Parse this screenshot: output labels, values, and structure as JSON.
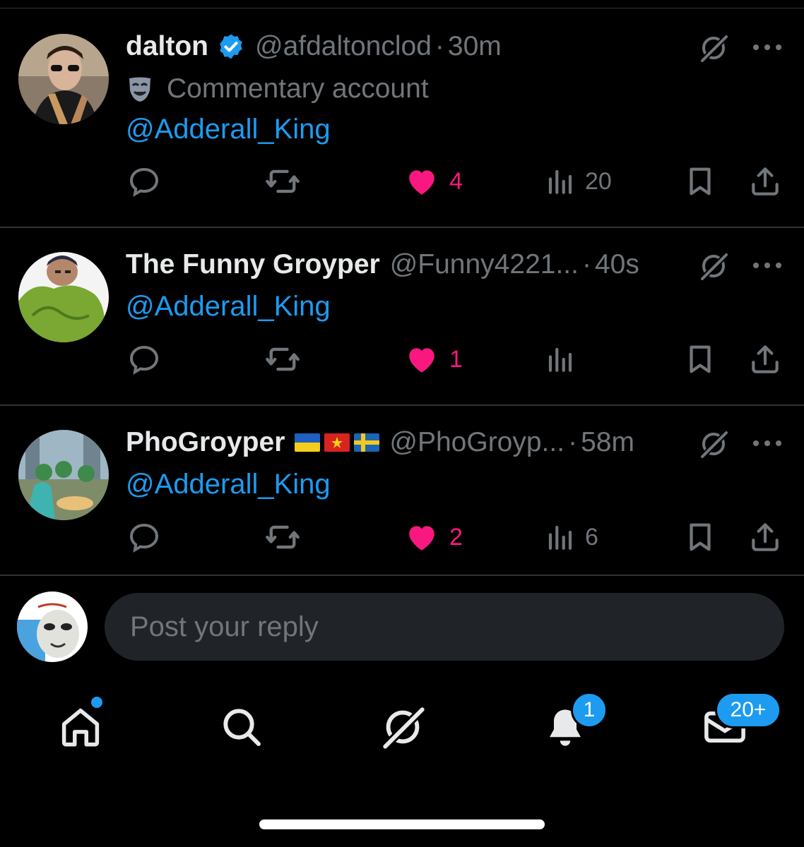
{
  "posts": [
    {
      "name": "dalton",
      "verified": true,
      "handle": "@afdaltonclod",
      "separator": "·",
      "time": "30m",
      "bio": "Commentary account",
      "bio_icon": "theater-mask-icon",
      "text": "@Adderall_King",
      "actions": {
        "replies": "",
        "reposts": "",
        "likes": "4",
        "liked": true,
        "views": "20"
      }
    },
    {
      "name": "The Funny Groyper",
      "verified": false,
      "handle": "@Funny4221...",
      "separator": "·",
      "time": "40s",
      "text": "@Adderall_King",
      "actions": {
        "replies": "",
        "reposts": "",
        "likes": "1",
        "liked": true,
        "views": ""
      }
    },
    {
      "name": "PhoGroyper",
      "verified": false,
      "flags": [
        "ukraine-flag",
        "vietnam-flag",
        "sweden-flag"
      ],
      "handle": "@PhoGroyp...",
      "separator": "·",
      "time": "58m",
      "text": "@Adderall_King",
      "actions": {
        "replies": "",
        "reposts": "",
        "likes": "2",
        "liked": true,
        "views": "6"
      }
    }
  ],
  "composer": {
    "placeholder": "Post your reply"
  },
  "nav": {
    "home_has_dot": true,
    "notifications_badge": "1",
    "messages_badge": "20+"
  },
  "colors": {
    "accent": "#1d9bf0",
    "like": "#f91880",
    "muted": "#71767b",
    "background": "#000000"
  }
}
